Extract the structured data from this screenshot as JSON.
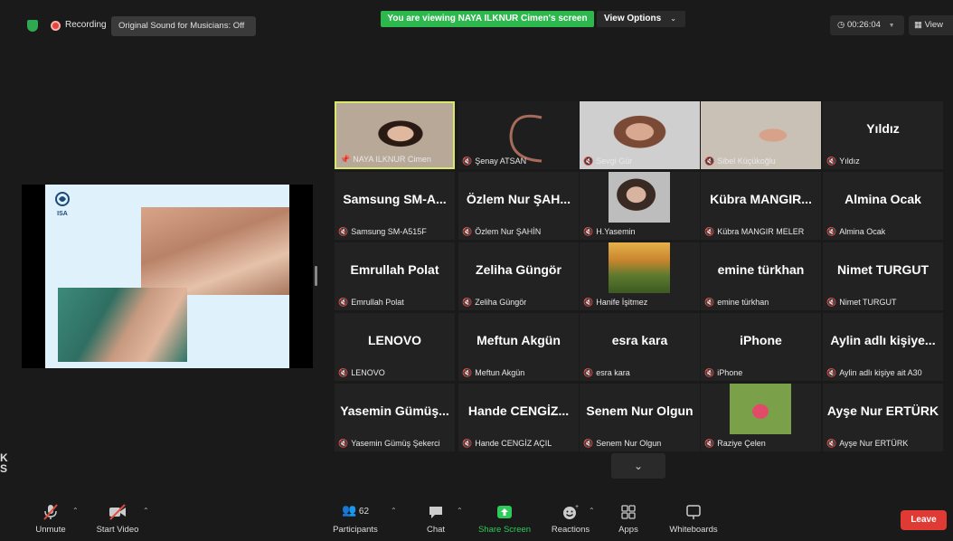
{
  "topbar": {
    "recording_label": "Recording",
    "original_sound": "Original Sound for Musicians: Off",
    "viewing_banner": "You are viewing NAYA ILKNUR Cimen's screen",
    "view_options": "View Options",
    "timer": "00:26:04",
    "view_label": "View"
  },
  "gallery": [
    {
      "display": "",
      "caption": "NAYA ILKNUR Cimen",
      "pinned": true,
      "active": true,
      "video": "face1"
    },
    {
      "display": "",
      "caption": "Şenay ATSAN",
      "video": "curve"
    },
    {
      "display": "",
      "caption": "Sevgi Gür",
      "video": "face2"
    },
    {
      "display": "",
      "caption": "Sibel Küçükoğlu",
      "video": "face3"
    },
    {
      "display": "Yıldız",
      "caption": "Yıldız"
    },
    {
      "display": "Samsung SM-A...",
      "caption": "Samsung SM-A515F"
    },
    {
      "display": "Özlem Nur ŞAH...",
      "caption": "Özlem Nur ŞAHİN"
    },
    {
      "display": "",
      "caption": "H.Yasemin",
      "video": "photo1"
    },
    {
      "display": "Kübra MANGIR...",
      "caption": "Kübra MANGIR MELER"
    },
    {
      "display": "Almina Ocak",
      "caption": "Almina Ocak"
    },
    {
      "display": "Emrullah Polat",
      "caption": "Emrullah Polat"
    },
    {
      "display": "Zeliha Güngör",
      "caption": "Zeliha Güngör"
    },
    {
      "display": "",
      "caption": "Hanife İşitmez",
      "video": "landscape"
    },
    {
      "display": "emine türkhan",
      "caption": "emine türkhan"
    },
    {
      "display": "Nimet TURGUT",
      "caption": "Nimet TURGUT"
    },
    {
      "display": "LENOVO",
      "caption": "LENOVO"
    },
    {
      "display": "Meftun Akgün",
      "caption": "Meftun Akgün"
    },
    {
      "display": "esra kara",
      "caption": "esra kara"
    },
    {
      "display": "iPhone",
      "caption": "iPhone"
    },
    {
      "display": "Aylin adlı kişiye...",
      "caption": "Aylin adlı kişiye ait A30"
    },
    {
      "display": "Yasemin Gümüş...",
      "caption": "Yasemin Gümüş Şekerci"
    },
    {
      "display": "Hande CENGİZ...",
      "caption": "Hande CENGİZ AÇIL"
    },
    {
      "display": "Senem Nur Olgun",
      "caption": "Senem Nur Olgun"
    },
    {
      "display": "",
      "caption": "Raziye Çelen",
      "video": "photo2"
    },
    {
      "display": "Ayşe Nur ERTÜRK",
      "caption": "Ayşe Nur ERTÜRK"
    }
  ],
  "slide": {
    "logo_text": "ISA"
  },
  "toolbar": {
    "unmute": "Unmute",
    "start_video": "Start Video",
    "participants": "Participants",
    "participants_count": "62",
    "chat": "Chat",
    "share_screen": "Share Screen",
    "reactions": "Reactions",
    "apps": "Apps",
    "whiteboards": "Whiteboards",
    "leave": "Leave"
  },
  "edge_text": "K\nS",
  "colors": {
    "green": "#2db84d",
    "leave_red": "#e03a35",
    "active_border": "#d8e86a",
    "muted_mic": "#e04b3e"
  }
}
